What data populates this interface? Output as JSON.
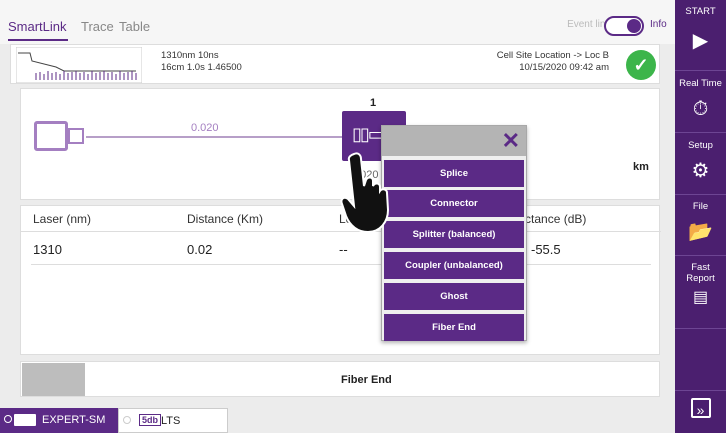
{
  "tabs": {
    "items": [
      {
        "label": "SmartLink"
      },
      {
        "label": "Trace"
      },
      {
        "label": "Table"
      }
    ],
    "event_line_label": "Event line",
    "info_label": "Info"
  },
  "infostrip": {
    "line1": "1310nm  10ns",
    "line2": "16cm  1.0s  1.46500",
    "location": "Cell Site Location -> Loc B",
    "datetime": "10/15/2020  09:42 am",
    "status_icon": "check-icon",
    "colors": {
      "status_ok": "#3cb54a"
    }
  },
  "linkview": {
    "distance_left": "0.020",
    "distance_event": "0.020",
    "event_number": "1",
    "unit": "km"
  },
  "results": {
    "headers": [
      "Laser (nm)",
      "Distance (Km)",
      "Loss (dB)",
      "Reflectance (dB)"
    ],
    "row": [
      "1310",
      "0.02",
      "--",
      "-55.5"
    ]
  },
  "popup": {
    "items": [
      "Splice",
      "Connector",
      "Splitter (balanced)",
      "Coupler (unbalanced)",
      "Ghost",
      "Fiber End"
    ]
  },
  "fiber_end_bar": {
    "label": "Fiber End"
  },
  "statusbar": {
    "module_label": "EXPERT-SM",
    "lts_label": "LTS",
    "lts_badge": "5db"
  },
  "sidebar": {
    "start": "START",
    "real_time": "Real Time",
    "setup": "Setup",
    "file": "File",
    "fast_report": "Fast Report"
  },
  "colors": {
    "accent": "#5b2a86",
    "sidebar": "#4b1f6f",
    "link_light": "#a47fc1"
  }
}
